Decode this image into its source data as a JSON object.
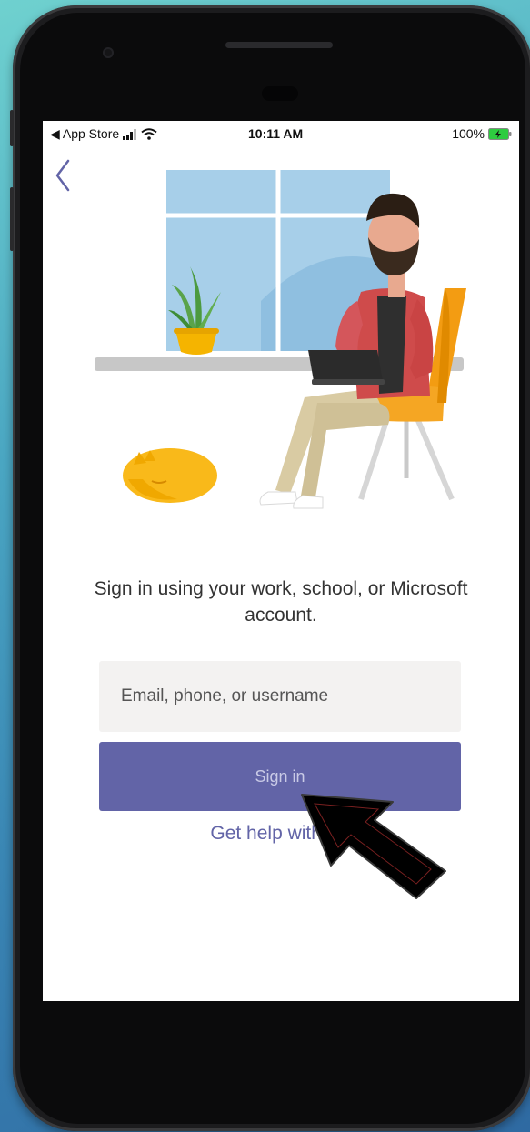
{
  "status_bar": {
    "back_app": "◀ App Store",
    "time": "10:11 AM",
    "battery": "100%"
  },
  "signin": {
    "prompt": "Sign in using your work, school, or Microsoft account.",
    "email_placeholder": "Email, phone, or username",
    "signin_button": "Sign in",
    "help_link": "Get help with sig"
  },
  "icons": {
    "back": "chevron-left-icon",
    "signal": "signal-bars-icon",
    "wifi": "wifi-icon",
    "battery": "battery-charging-icon",
    "pointer": "arrow-pointer-icon"
  },
  "colors": {
    "brand": "#6264a7",
    "field_bg": "#f3f2f1",
    "background_top": "#6fd1cf",
    "background_bottom": "#2f6aa2"
  }
}
